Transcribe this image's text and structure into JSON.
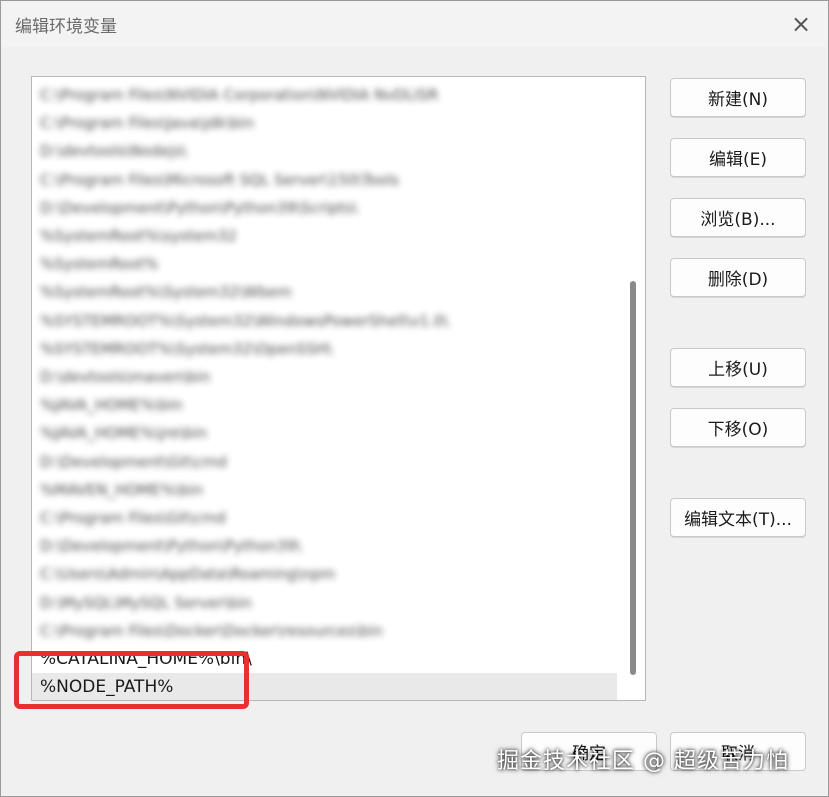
{
  "dialog": {
    "title": "编辑环境变量",
    "close_icon": "×"
  },
  "list": {
    "items": [
      {
        "text": "C:\\Program Files\\NVIDIA Corporation\\NVIDIA NvDLISR",
        "blurred": true
      },
      {
        "text": "C:\\Program Files\\Java\\jdk\\bin",
        "blurred": true
      },
      {
        "text": "D:\\devtools\\Nodejs\\",
        "blurred": true
      },
      {
        "text": "C:\\Program Files\\Microsoft SQL Server\\150\\Tools",
        "blurred": true
      },
      {
        "text": "D:\\Development\\Python\\Python39\\Scripts\\",
        "blurred": true
      },
      {
        "text": "%SystemRoot%\\system32",
        "blurred": true
      },
      {
        "text": "%SystemRoot%",
        "blurred": true
      },
      {
        "text": "%SystemRoot%\\System32\\Wbem",
        "blurred": true
      },
      {
        "text": "%SYSTEMROOT%\\System32\\WindowsPowerShell\\v1.0\\",
        "blurred": true
      },
      {
        "text": "%SYSTEMROOT%\\System32\\OpenSSH\\",
        "blurred": true
      },
      {
        "text": "D:\\devtools\\maven\\bin",
        "blurred": true
      },
      {
        "text": "%JAVA_HOME%\\bin",
        "blurred": true
      },
      {
        "text": "%JAVA_HOME%\\jre\\bin",
        "blurred": true
      },
      {
        "text": "D:\\Development\\Git\\cmd",
        "blurred": true
      },
      {
        "text": "%MAVEN_HOME%\\bin",
        "blurred": true
      },
      {
        "text": "C:\\Program Files\\Git\\cmd",
        "blurred": true
      },
      {
        "text": "D:\\Development\\Python\\Python39\\",
        "blurred": true
      },
      {
        "text": "C:\\Users\\Admin\\AppData\\Roaming\\npm",
        "blurred": true
      },
      {
        "text": "D:\\MySQL\\MySQL Server\\bin",
        "blurred": true
      },
      {
        "text": "C:\\Program Files\\Docker\\Docker\\resources\\bin",
        "blurred": true
      },
      {
        "text": "%CATALINA_HOME%\\bin\\",
        "blurred": false
      },
      {
        "text": "%NODE_PATH%",
        "blurred": false,
        "selected": true
      }
    ]
  },
  "buttons": {
    "new": "新建(N)",
    "edit": "编辑(E)",
    "browse": "浏览(B)...",
    "delete": "删除(D)",
    "move_up": "上移(U)",
    "move_down": "下移(O)",
    "edit_text": "编辑文本(T)...",
    "ok": "确定",
    "cancel": "取消"
  },
  "watermark": "掘金技术社区 @ 超级苦力怕",
  "colors": {
    "highlight": "#e8302f",
    "dialog_bg": "#f0f0f0"
  }
}
